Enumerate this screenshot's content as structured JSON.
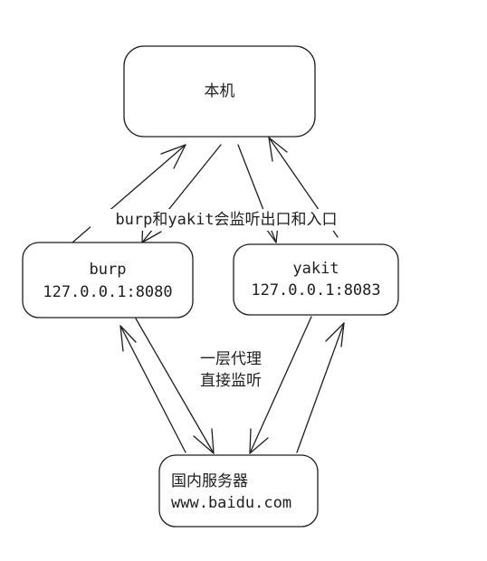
{
  "nodes": {
    "host": {
      "label": "本机"
    },
    "burp": {
      "line1": "burp",
      "line2": "127.0.0.1:8080"
    },
    "yakit": {
      "line1": "yakit",
      "line2": "127.0.0.1:8083"
    },
    "server": {
      "line1": "国内服务器",
      "line2": "www.baidu.com"
    }
  },
  "annotations": {
    "top": "burp和yakit会监听出口和入口",
    "middle_line1": "一层代理",
    "middle_line2": "直接监听"
  },
  "style": {
    "stroke": "#1e1e1e",
    "background": "#ffffff"
  }
}
